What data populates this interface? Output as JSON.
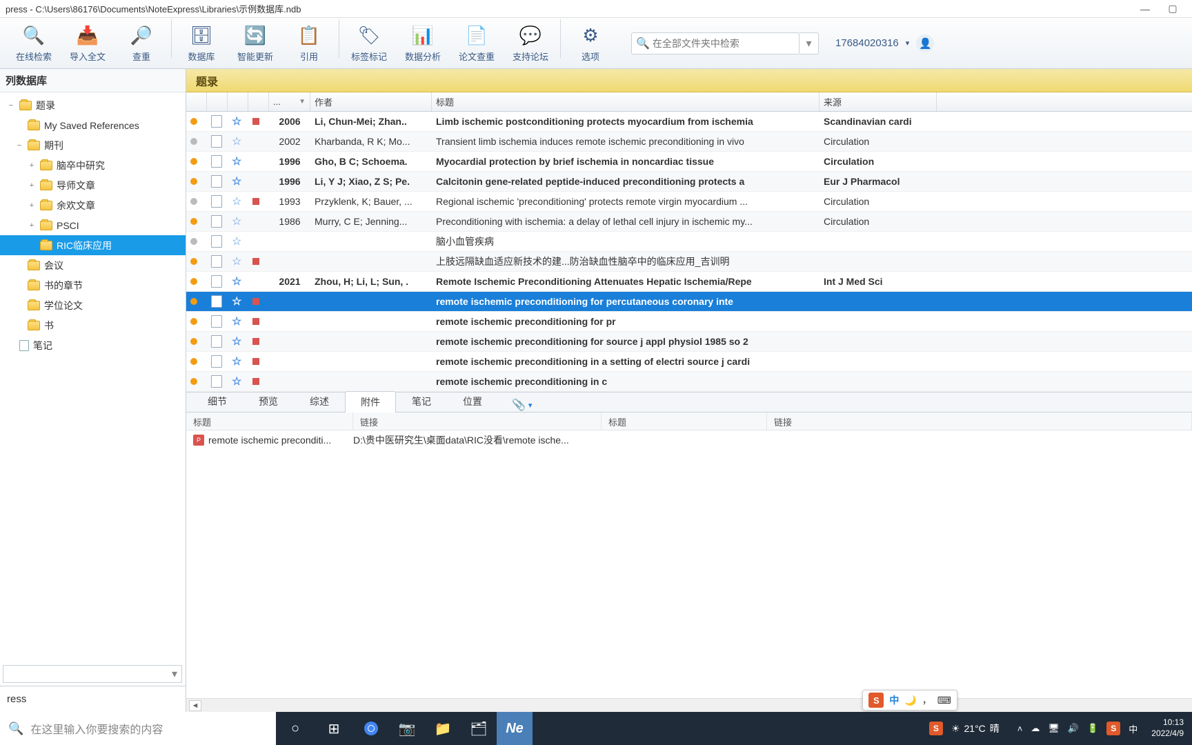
{
  "window": {
    "title": "press - C:\\Users\\86176\\Documents\\NoteExpress\\Libraries\\示例数据库.ndb"
  },
  "toolbar": {
    "items": [
      {
        "label": "在线检索"
      },
      {
        "label": "导入全文"
      },
      {
        "label": "查重"
      },
      {
        "label": "数据库"
      },
      {
        "label": "智能更新"
      },
      {
        "label": "引用"
      },
      {
        "label": "标签标记"
      },
      {
        "label": "数据分析"
      },
      {
        "label": "论文查重"
      },
      {
        "label": "支持论坛"
      },
      {
        "label": "选项"
      }
    ],
    "search_placeholder": "在全部文件夹中检索",
    "user": "17684020316"
  },
  "sidebar": {
    "root": "列数据库",
    "items": [
      {
        "label": "题录",
        "icon": "folder",
        "indent": 0,
        "exp": "−"
      },
      {
        "label": "My Saved References",
        "icon": "folder",
        "indent": 1,
        "exp": ""
      },
      {
        "label": "期刊",
        "icon": "folder",
        "indent": 1,
        "exp": "−"
      },
      {
        "label": "脑卒中研究",
        "icon": "folder",
        "indent": 2,
        "exp": "+"
      },
      {
        "label": "导师文章",
        "icon": "folder",
        "indent": 2,
        "exp": "+"
      },
      {
        "label": "余欢文章",
        "icon": "folder",
        "indent": 2,
        "exp": "+"
      },
      {
        "label": "PSCI",
        "icon": "folder",
        "indent": 2,
        "exp": "+"
      },
      {
        "label": "RIC临床应用",
        "icon": "folder",
        "indent": 2,
        "exp": "",
        "selected": true
      },
      {
        "label": "会议",
        "icon": "folder",
        "indent": 1,
        "exp": ""
      },
      {
        "label": "书的章节",
        "icon": "folder",
        "indent": 1,
        "exp": ""
      },
      {
        "label": "学位论文",
        "icon": "folder",
        "indent": 1,
        "exp": ""
      },
      {
        "label": "书",
        "icon": "folder",
        "indent": 1,
        "exp": ""
      },
      {
        "label": "笔记",
        "icon": "doc",
        "indent": 0,
        "exp": ""
      }
    ],
    "brand": "ress"
  },
  "content": {
    "heading": "题录",
    "columns": {
      "year": "...",
      "author": "作者",
      "title": "标题",
      "source": "来源"
    },
    "rows": [
      {
        "dot": "o",
        "star": true,
        "flag": "r",
        "bold": true,
        "year": "2006",
        "author": "Li, Chun-Mei; Zhan..",
        "title": "Limb ischemic postconditioning protects myocardium from ischemia",
        "source": "Scandinavian cardi"
      },
      {
        "dot": "g",
        "star": true,
        "flag": "",
        "bold": false,
        "year": "2002",
        "author": "Kharbanda, R K; Mo...",
        "title": "Transient limb ischemia induces remote ischemic preconditioning in vivo",
        "source": "Circulation"
      },
      {
        "dot": "o",
        "star": true,
        "flag": "",
        "bold": true,
        "year": "1996",
        "author": "Gho, B C; Schoema.",
        "title": "Myocardial protection by brief ischemia in noncardiac tissue",
        "source": "Circulation"
      },
      {
        "dot": "o",
        "star": true,
        "flag": "",
        "bold": true,
        "year": "1996",
        "author": "Li, Y J; Xiao, Z S; Pe.",
        "title": "Calcitonin gene-related peptide-induced preconditioning protects a",
        "source": "Eur J Pharmacol"
      },
      {
        "dot": "g",
        "star": true,
        "flag": "r",
        "bold": false,
        "year": "1993",
        "author": "Przyklenk, K; Bauer, ...",
        "title": "Regional ischemic 'preconditioning' protects remote virgin myocardium ...",
        "source": "Circulation"
      },
      {
        "dot": "o",
        "star": true,
        "flag": "",
        "bold": false,
        "year": "1986",
        "author": "Murry, C E; Jenning...",
        "title": "Preconditioning with ischemia: a delay of lethal cell injury in ischemic my...",
        "source": "Circulation"
      },
      {
        "dot": "g",
        "star": true,
        "flag": "",
        "bold": false,
        "year": "",
        "author": "",
        "title": "脑小血管疾病",
        "source": ""
      },
      {
        "dot": "o",
        "star": true,
        "flag": "r",
        "bold": false,
        "year": "",
        "author": "",
        "title": "上肢远隔缺血适应新技术的建...防治缺血性脑卒中的临床应用_吉训明",
        "source": ""
      },
      {
        "dot": "o",
        "star": true,
        "flag": "",
        "bold": true,
        "year": "2021",
        "author": "Zhou, H; Li, L; Sun, .",
        "title": "Remote Ischemic Preconditioning Attenuates Hepatic Ischemia/Repe",
        "source": "Int J Med Sci"
      },
      {
        "dot": "o",
        "star": true,
        "flag": "r",
        "bold": true,
        "year": "",
        "author": "",
        "title": "remote ischemic preconditioning for percutaneous coronary inte",
        "source": "",
        "selected": true
      },
      {
        "dot": "o",
        "star": true,
        "flag": "r",
        "bold": true,
        "year": "",
        "author": "",
        "title": "remote ischemic preconditioning for pr",
        "source": ""
      },
      {
        "dot": "o",
        "star": true,
        "flag": "r",
        "bold": true,
        "year": "",
        "author": "",
        "title": "remote ischemic preconditioning for source j appl physiol 1985 so 2",
        "source": ""
      },
      {
        "dot": "o",
        "star": true,
        "flag": "r",
        "bold": true,
        "year": "",
        "author": "",
        "title": "remote ischemic preconditioning in a setting of electri source j cardi",
        "source": ""
      },
      {
        "dot": "o",
        "star": true,
        "flag": "r",
        "bold": true,
        "year": "",
        "author": "",
        "title": "remote ischemic preconditioning in c",
        "source": ""
      }
    ]
  },
  "detail": {
    "tabs": [
      "细节",
      "预览",
      "综述",
      "附件",
      "笔记",
      "位置"
    ],
    "active_tab": "附件",
    "headers": [
      "标题",
      "链接",
      "标题",
      "链接"
    ],
    "row": {
      "title": "remote ischemic preconditi...",
      "link": "D:\\贵中医研究生\\桌面data\\RIC没看\\remote ische..."
    }
  },
  "ime": {
    "s": "S",
    "zh": "中",
    "moon": "🌙",
    "comma": "，",
    "kb": "⌨"
  },
  "taskbar": {
    "search_placeholder": "在这里输入你要搜索的内容",
    "weather_temp": "21°C",
    "weather_desc": "晴",
    "time": "10:13",
    "date": "2022/4/9"
  }
}
